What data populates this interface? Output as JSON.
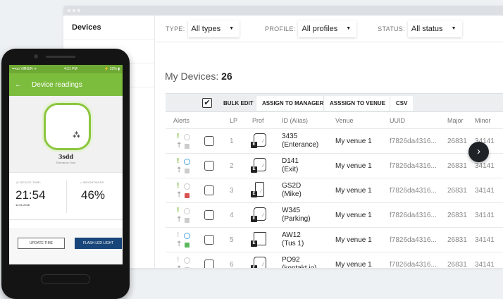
{
  "sidebar": {
    "items": [
      {
        "label": "Devices"
      }
    ]
  },
  "filters": {
    "type": {
      "label": "TYPE:",
      "value": "All types"
    },
    "profile": {
      "label": "PROFILE:",
      "value": "All profiles"
    },
    "status": {
      "label": "STATUS:",
      "value": "All status"
    }
  },
  "heading": {
    "prefix": "My Devices:",
    "count": "26"
  },
  "toolbar": {
    "bulk_edit": "BULK EDIT",
    "assign_manager": "ASSIGN TO MANAGER",
    "assign_venue": "ASSSIGN TO VENUE",
    "csv": "CSV"
  },
  "columns": {
    "alerts": "Alerts",
    "lp": "LP",
    "prof": "Prof",
    "id": "ID (Alias)",
    "venue": "Venue",
    "uuid": "UUID",
    "major": "Major",
    "minor": "Minor"
  },
  "rows": [
    {
      "lp": "1",
      "id": "3435",
      "alias": "(Enterance)",
      "venue": "My venue 1",
      "uuid": "f7826da4316...",
      "major": "26831",
      "minor": "34141",
      "ex_color": "#6bb52f",
      "clock": "grey",
      "lock": "grey",
      "device": "beacon"
    },
    {
      "lp": "2",
      "id": "D141",
      "alias": "(Exit)",
      "venue": "My venue 1",
      "uuid": "f7826da4316...",
      "major": "26831",
      "minor": "34141",
      "ex_color": "#6bb52f",
      "clock": "blue",
      "lock": "grey",
      "device": "beacon"
    },
    {
      "lp": "3",
      "id": "GS2D",
      "alias": "(Mike)",
      "venue": "My venue 1",
      "uuid": "f7826da4316...",
      "major": "26831",
      "minor": "34141",
      "ex_color": "#6bb52f",
      "clock": "grey",
      "lock": "red",
      "device": "tall"
    },
    {
      "lp": "4",
      "id": "W345",
      "alias": "(Parking)",
      "venue": "My venue 1",
      "uuid": "f7826da4316...",
      "major": "26831",
      "minor": "34141",
      "ex_color": "#6bb52f",
      "clock": "grey",
      "lock": "grey",
      "device": "beacon"
    },
    {
      "lp": "5",
      "id": "AW12",
      "alias": "(Tus 1)",
      "venue": "My venue 1",
      "uuid": "f7826da4316...",
      "major": "26831",
      "minor": "34141",
      "ex_color": "#cccccc",
      "clock": "blue",
      "lock": "green",
      "device": "square"
    },
    {
      "lp": "6",
      "id": "PO92",
      "alias": "(kontakt.io)",
      "venue": "My venue 1",
      "uuid": "f7826da4316...",
      "major": "26831",
      "minor": "34141",
      "ex_color": "#cccccc",
      "clock": "grey",
      "lock": "grey",
      "device": "beacon"
    }
  ],
  "phone": {
    "status_left": "•••oo VIRGIN ᯤ",
    "status_time": "4:21 PM",
    "status_right": "⚡ 22% ▮",
    "title": "Device readings",
    "device_name": "3sdd",
    "device_sub": "Enterance Door",
    "device_time_label": "◷ DEVICE TIME:",
    "device_time": "21:54",
    "device_date": "12.01.2016",
    "brightness_label": "☼ BRIGHTNESS:",
    "brightness": "46%",
    "update_btn": "UPDATE TIME",
    "flash_btn": "FLASH LED LIGHT"
  },
  "colors": {
    "accent_green": "#7cbd3d",
    "dark_blue": "#18467a",
    "lock_red": "#d9534f",
    "lock_green": "#5cb85c",
    "clock_blue": "#4aa3df"
  }
}
